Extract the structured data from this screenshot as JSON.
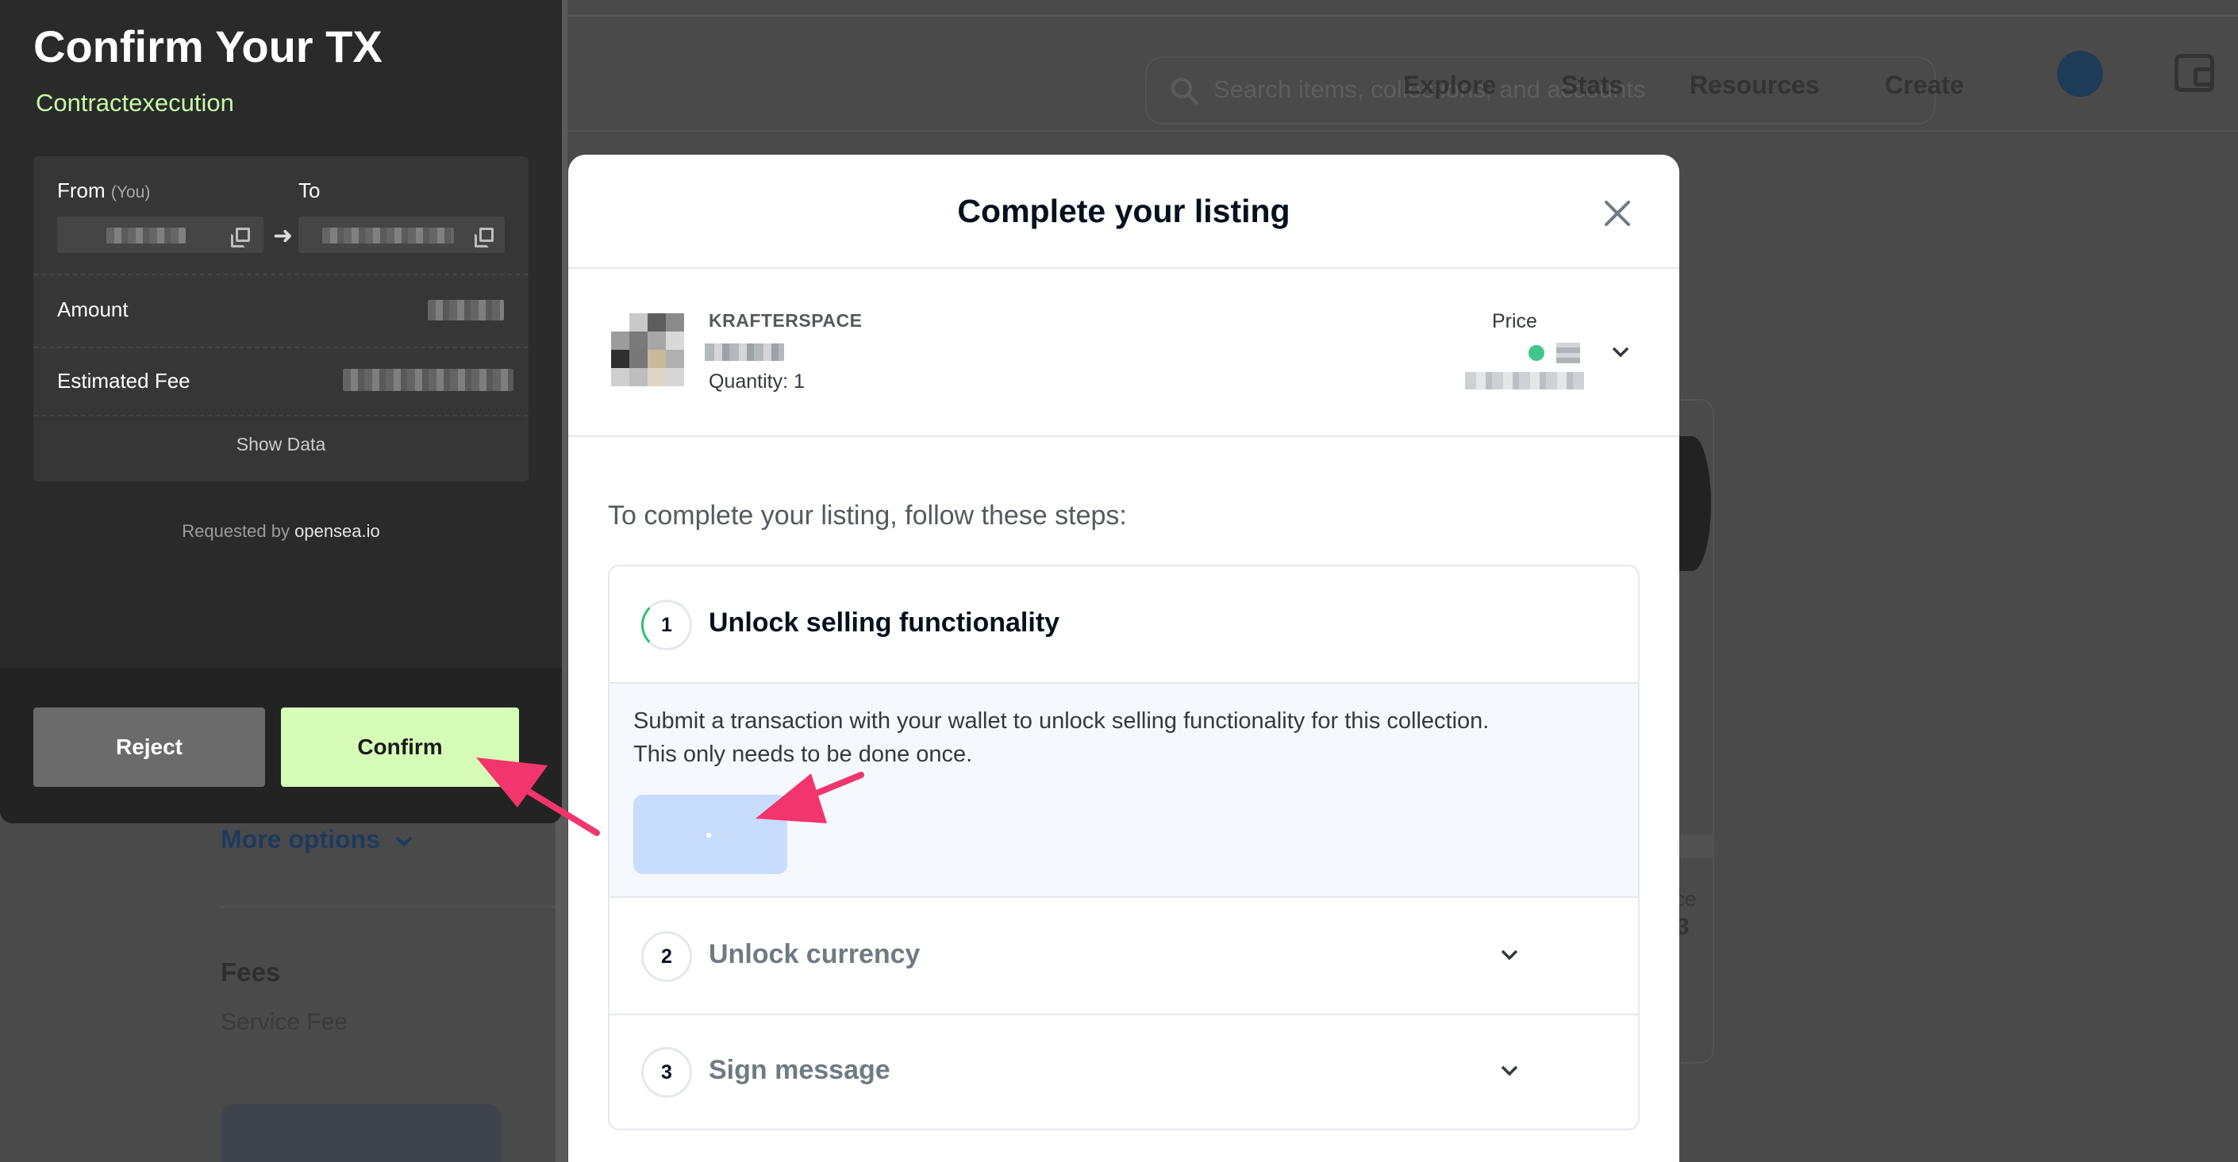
{
  "background": {
    "search_placeholder": "Search items, collections, and accounts",
    "nav": [
      "Explore",
      "Stats",
      "Resources",
      "Create"
    ],
    "more_options": "More options",
    "fees_heading": "Fees",
    "service_fee_label": "Service Fee",
    "card_label_fragment": "ce",
    "card_value_fragment": "3"
  },
  "wallet": {
    "title": "Confirm Your TX",
    "subtitle": "Contractexecution",
    "from_label": "From",
    "from_you": "(You)",
    "to_label": "To",
    "amount_label": "Amount",
    "fee_label": "Estimated Fee",
    "show_data": "Show Data",
    "requested_by_prefix": "Requested by",
    "requested_by_site": "opensea.io",
    "reject_label": "Reject",
    "confirm_label": "Confirm",
    "accent_color": "#c7f9a8"
  },
  "modal": {
    "title": "Complete your listing",
    "collection": "KRAFTERSPACE",
    "quantity": "Quantity: 1",
    "price_label": "Price",
    "intro": "To complete your listing, follow these steps:",
    "steps": [
      {
        "number": "1",
        "title": "Unlock selling functionality",
        "description": "Submit a transaction with your wallet to unlock selling functionality for this collection. This only needs to be done once.",
        "expanded": true
      },
      {
        "number": "2",
        "title": "Unlock currency",
        "expanded": false
      },
      {
        "number": "3",
        "title": "Sign message",
        "expanded": false
      }
    ]
  },
  "colors": {
    "annotation_arrow": "#f2356d",
    "step_progress": "#2bc26c",
    "step_button": "#c8dcfc"
  }
}
